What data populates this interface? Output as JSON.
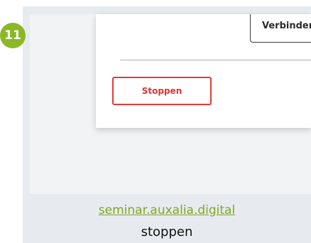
{
  "step": {
    "number": "11",
    "color": "#8bb825"
  },
  "dialog": {
    "connect_button_label": "Verbinden",
    "stop_button_label": "Stoppen",
    "stop_color": "#e03a3a"
  },
  "caption": {
    "link": "seminar.auxalia.digital",
    "text": "stoppen"
  }
}
